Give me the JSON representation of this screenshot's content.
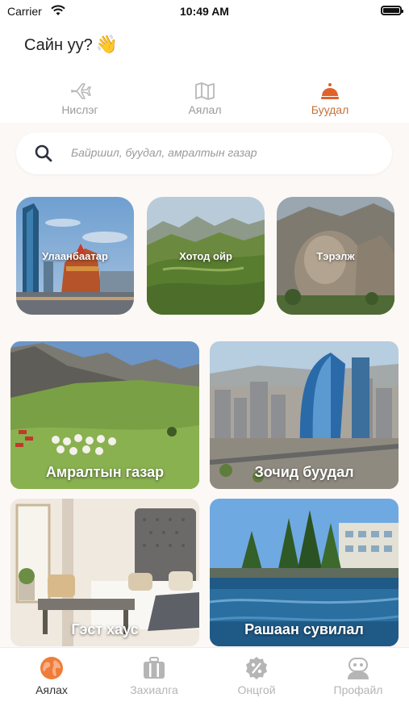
{
  "status": {
    "carrier": "Carrier",
    "time": "10:49 AM"
  },
  "greeting": {
    "text": "Сайн уу?",
    "emoji": "👋"
  },
  "top_tabs": [
    {
      "label": "Нислэг",
      "icon": "airplane-icon",
      "active": false
    },
    {
      "label": "Аялал",
      "icon": "map-icon",
      "active": false
    },
    {
      "label": "Буудал",
      "icon": "concierge-bell-icon",
      "active": true
    }
  ],
  "search": {
    "placeholder": "Байршил, буудал, амралтын газар"
  },
  "destinations": [
    {
      "label": "Улаанбаатар"
    },
    {
      "label": "Хотод ойр"
    },
    {
      "label": "Тэрэлж"
    }
  ],
  "categories": [
    {
      "label": "Амралтын газар"
    },
    {
      "label": "Зочид буудал"
    },
    {
      "label": "Гэст хаус"
    },
    {
      "label": "Рашаан сувилал"
    }
  ],
  "bottom_tabs": [
    {
      "label": "Аялах",
      "icon": "globe-icon",
      "active": true
    },
    {
      "label": "Захиалга",
      "icon": "suitcase-icon",
      "active": false
    },
    {
      "label": "Онцгой",
      "icon": "discount-badge-icon",
      "active": false
    },
    {
      "label": "Профайл",
      "icon": "profile-avatar-icon",
      "active": false
    }
  ],
  "colors": {
    "accent": "#c5713a",
    "background": "#fbf8f5",
    "inactive": "#9b9b9b"
  }
}
